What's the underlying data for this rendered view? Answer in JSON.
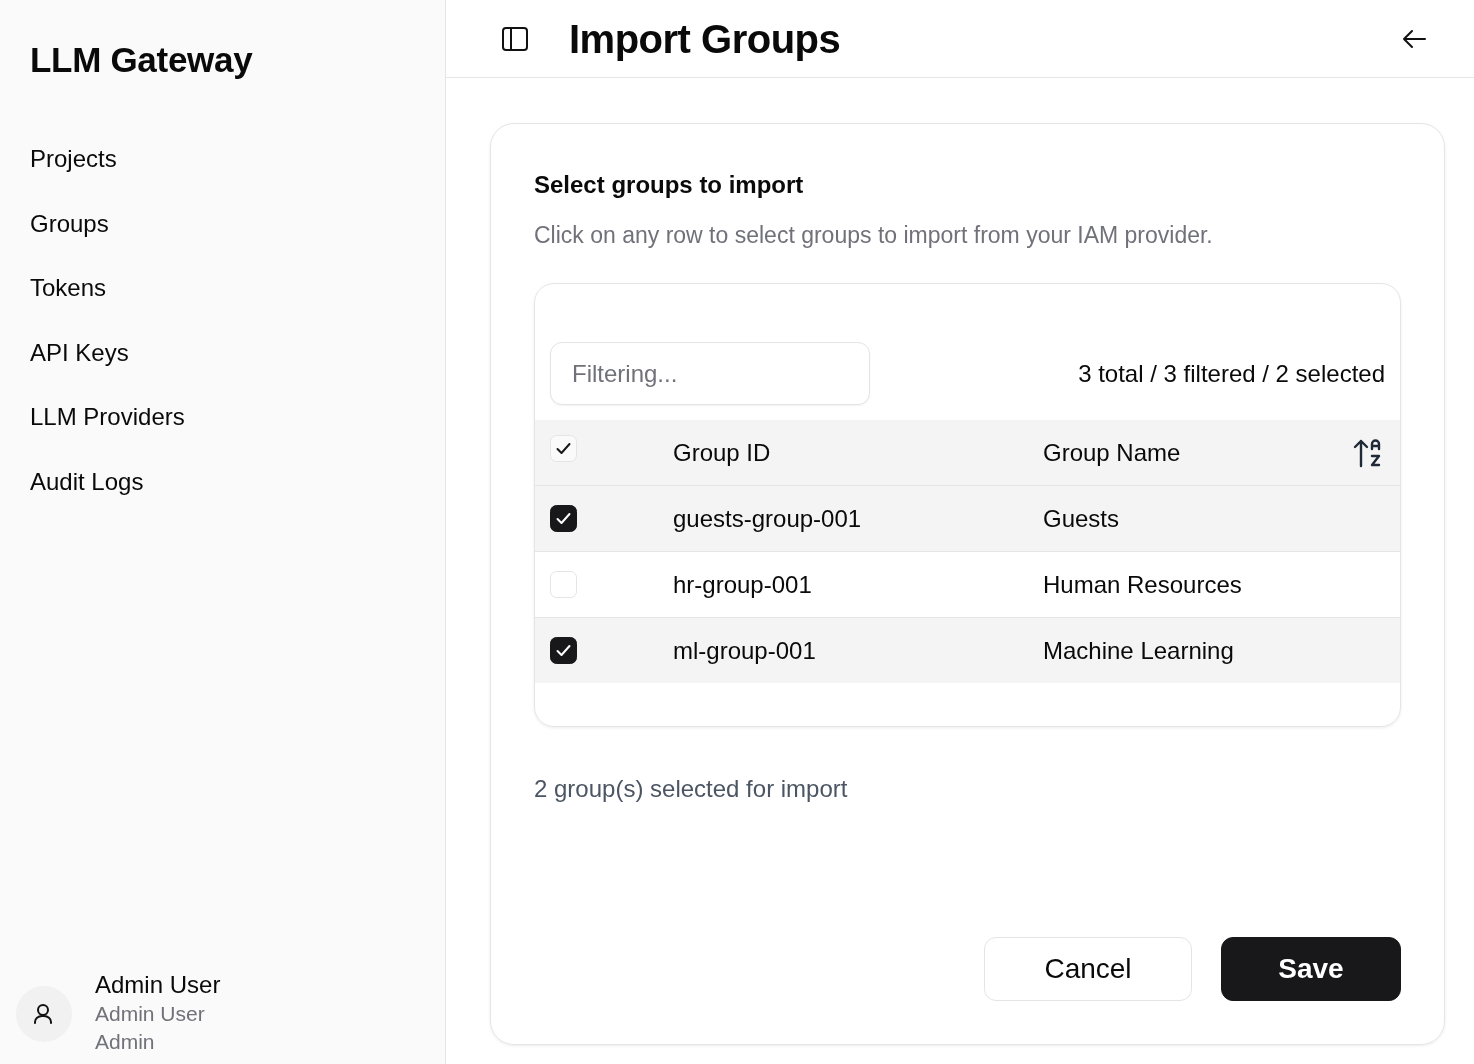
{
  "sidebar": {
    "title": "LLM Gateway",
    "items": [
      {
        "label": "Projects"
      },
      {
        "label": "Groups"
      },
      {
        "label": "Tokens"
      },
      {
        "label": "API Keys"
      },
      {
        "label": "LLM Providers"
      },
      {
        "label": "Audit Logs"
      }
    ],
    "user": {
      "name": "Admin User",
      "display_name": "Admin User",
      "role": "Admin"
    }
  },
  "header": {
    "title": "Import Groups"
  },
  "card": {
    "title": "Select groups to import",
    "description": "Click on any row to select groups to import from your IAM provider.",
    "filter": {
      "placeholder": "Filtering..."
    },
    "counter": "3 total / 3 filtered / 2 selected",
    "table": {
      "select_all_checked": true,
      "columns": [
        "Group ID",
        "Group Name"
      ],
      "rows": [
        {
          "id": "guests-group-001",
          "name": "Guests",
          "selected": true
        },
        {
          "id": "hr-group-001",
          "name": "Human Resources",
          "selected": false
        },
        {
          "id": "ml-group-001",
          "name": "Machine Learning",
          "selected": true
        }
      ]
    },
    "summary": "2 group(s) selected for import",
    "buttons": [
      {
        "label": "Cancel",
        "kind": "secondary"
      },
      {
        "label": "Save",
        "kind": "primary"
      }
    ]
  }
}
